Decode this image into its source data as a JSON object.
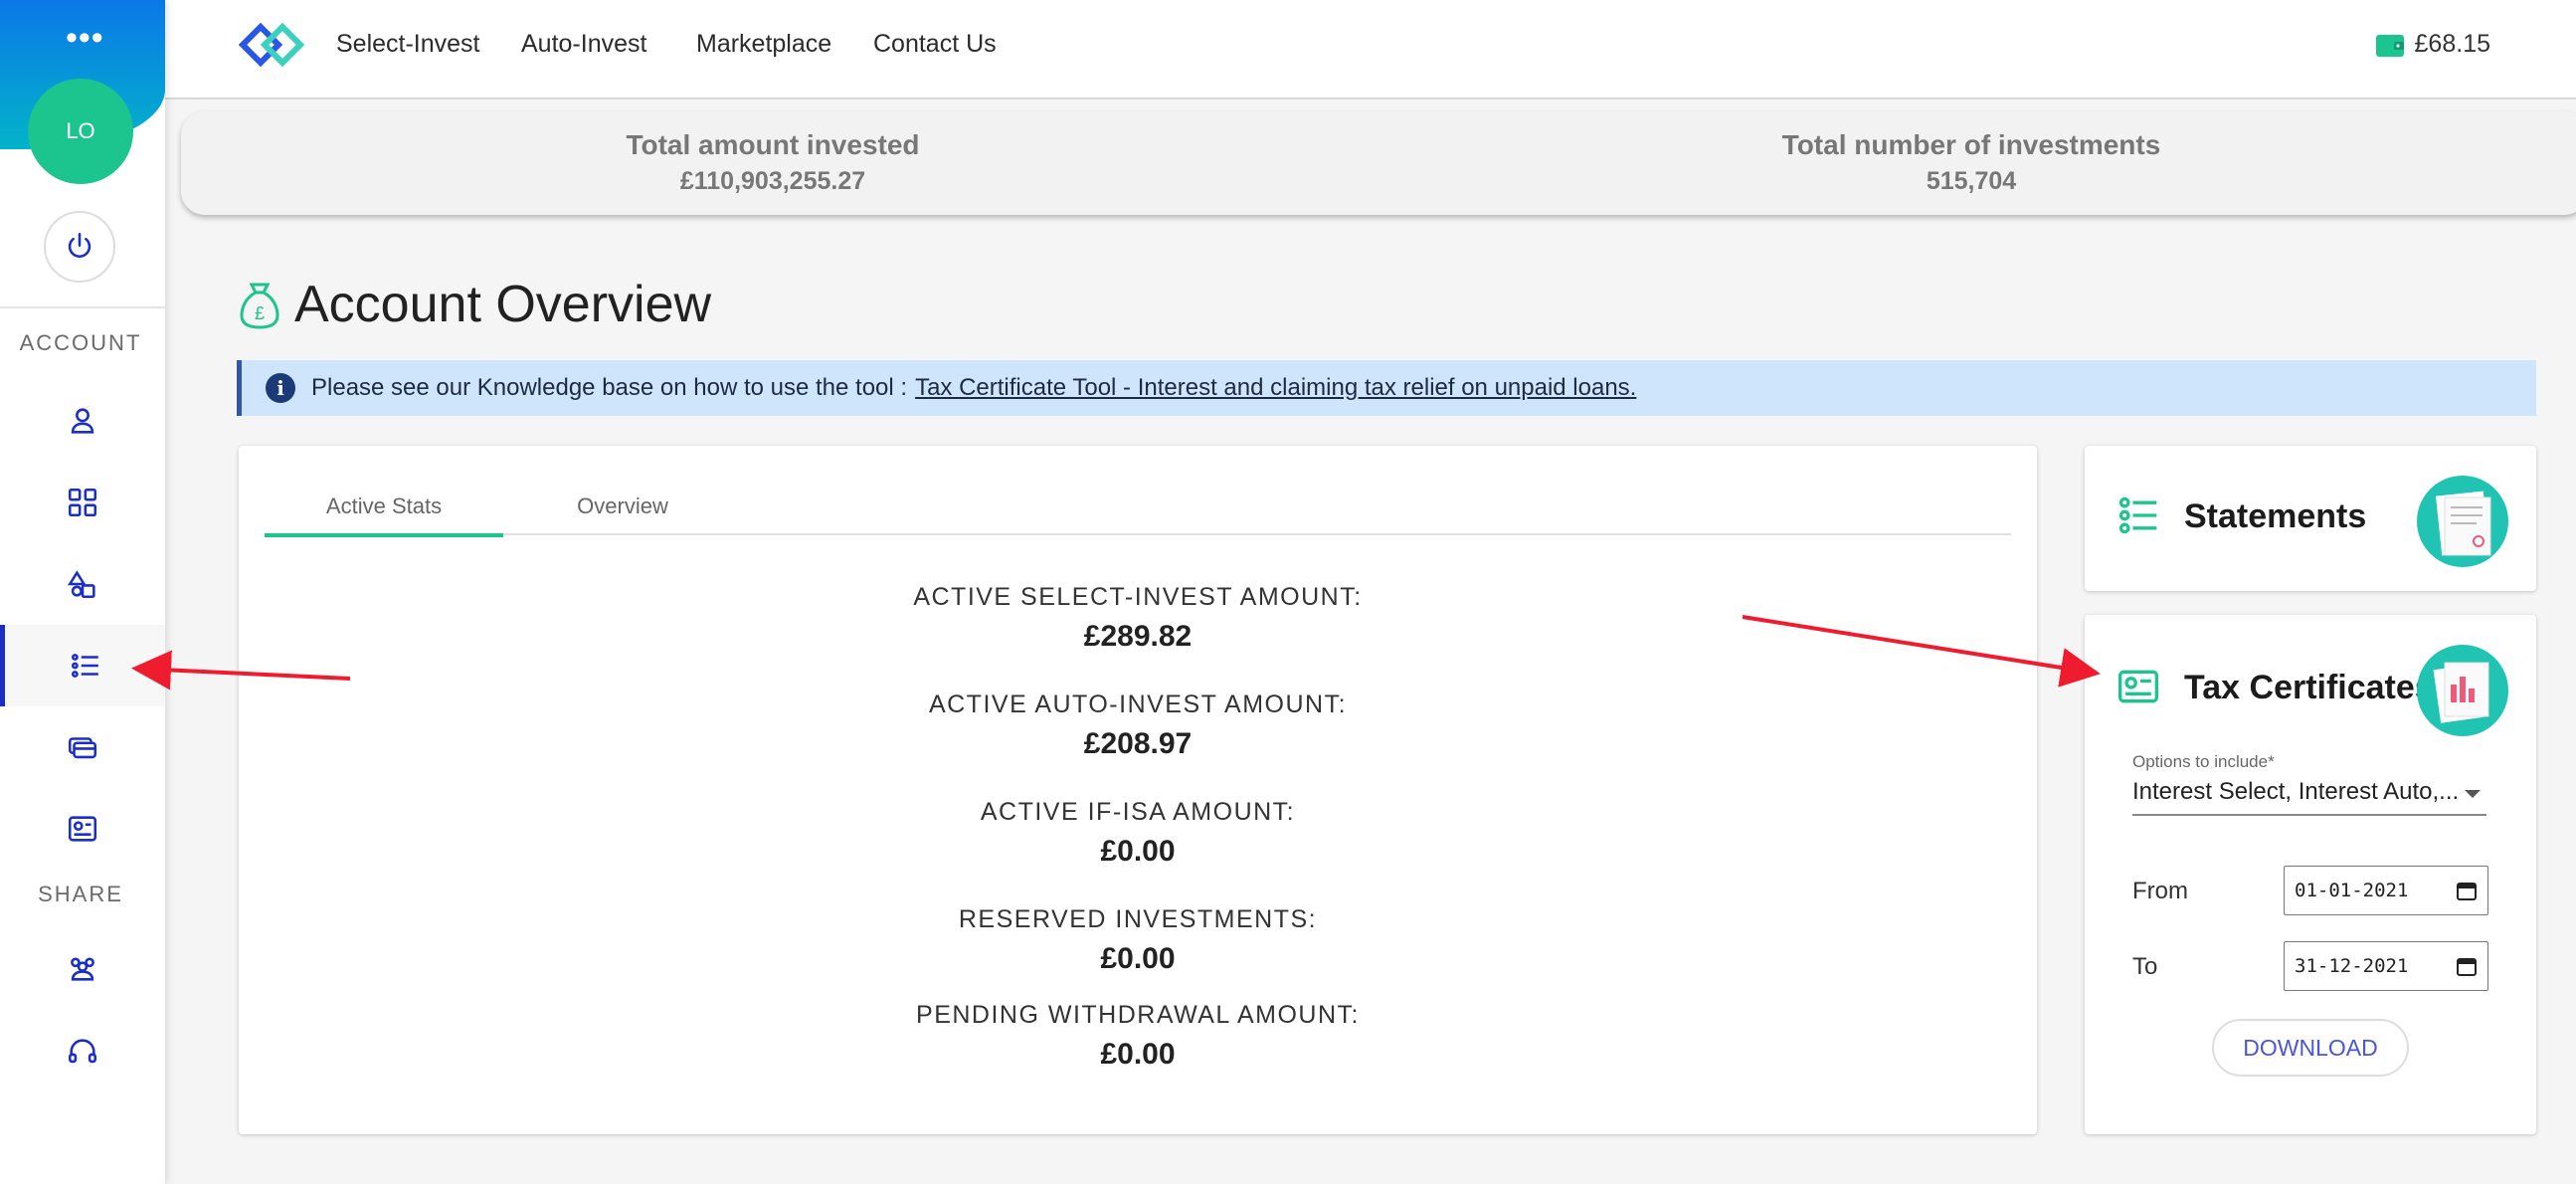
{
  "sidebar": {
    "avatar_initials": "LO",
    "account_heading": "ACCOUNT",
    "share_heading": "SHARE",
    "icons": [
      "user-icon",
      "grid-icon",
      "shapes-icon",
      "list-icon",
      "cards-icon",
      "certificate-icon",
      "group-icon",
      "headset-icon"
    ],
    "accent_color": "#1b2fc7"
  },
  "header": {
    "nav": [
      "Select-Invest",
      "Auto-Invest",
      "Marketplace",
      "Contact Us"
    ],
    "wallet_balance": "£68.15"
  },
  "stats": {
    "total_invested_label": "Total amount invested",
    "total_invested_value": "£110,903,255.27",
    "total_investments_label": "Total number of investments",
    "total_investments_value": "515,704"
  },
  "page": {
    "title": "Account Overview"
  },
  "banner": {
    "text": "Please see our Knowledge base on how to use the tool :",
    "link_text": "Tax Certificate Tool - Interest and claiming tax relief on unpaid loans."
  },
  "tabs": [
    "Active Stats",
    "Overview"
  ],
  "active_stats": [
    {
      "label": "ACTIVE SELECT-INVEST AMOUNT:",
      "value": "£289.82"
    },
    {
      "label": "ACTIVE AUTO-INVEST AMOUNT:",
      "value": "£208.97"
    },
    {
      "label": "ACTIVE IF-ISA AMOUNT:",
      "value": "£0.00"
    },
    {
      "label": "RESERVED INVESTMENTS:",
      "value": "£0.00"
    },
    {
      "label": "PENDING WITHDRAWAL AMOUNT:",
      "value": "£0.00"
    }
  ],
  "statements": {
    "title": "Statements"
  },
  "tax_certificates": {
    "title": "Tax Certificates",
    "options_label": "Options to include*",
    "options_value": "Interest Select, Interest Auto,...",
    "from_label": "From",
    "from_value": "01-01-2021",
    "to_label": "To",
    "to_value": "31-12-2021",
    "download_label": "DOWNLOAD"
  },
  "colors": {
    "green": "#1cc48e",
    "teal": "#21c3b3",
    "annotation_arrow": "#ee1c2e"
  }
}
